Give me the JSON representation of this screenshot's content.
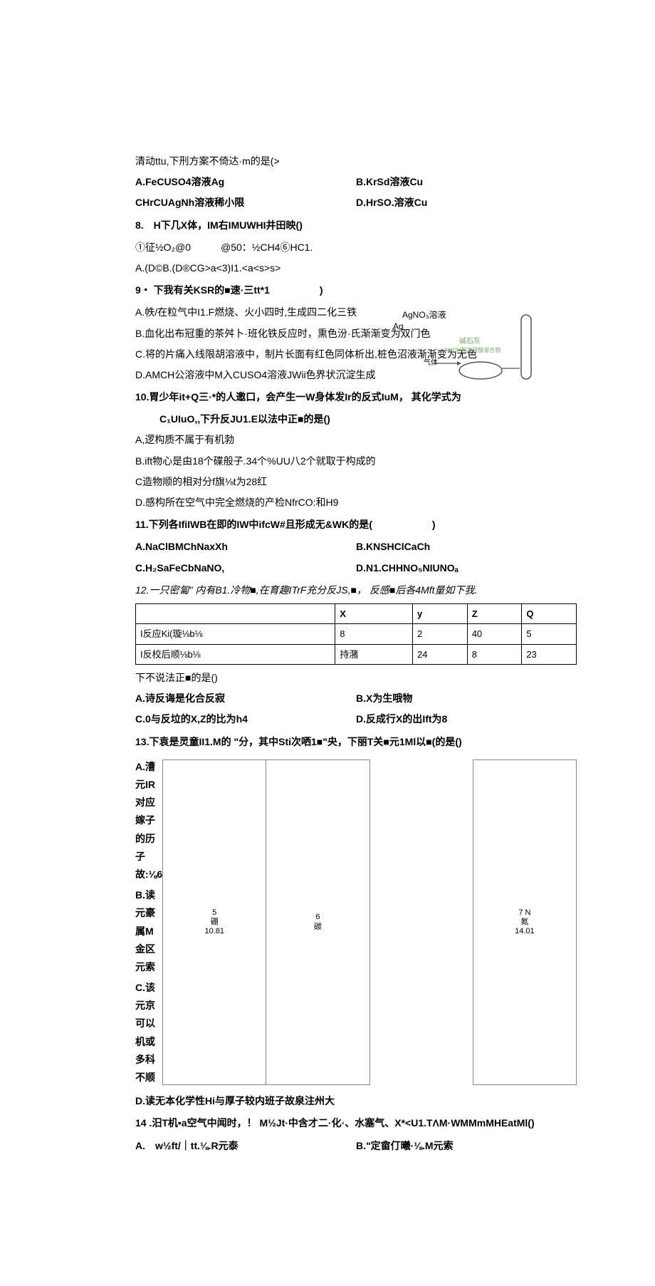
{
  "q7": {
    "stem": "清动ttu,下刑方案不倚达·m的是(>",
    "optA": "A.FeCUSO4溶液Ag",
    "optB": "B.KrSd溶液Cu",
    "optC": "CHrCUAgNh溶液稀小限",
    "optD": "D.HrSO.溶液Cu",
    "fig_label1": "AgNO₃溶液",
    "fig_label2": "Ag",
    "fig_label3": "碱石灰",
    "fig_label4": "NaOH和浓硫酸混合物",
    "fig_label5": "气体"
  },
  "q8": {
    "stem": "8.　H下几X体，IM右IMUWHI井田映()",
    "circled": "①征½O₂@0　　　@50：½CH4⑥HC1.",
    "answers": "A.(D©B.(D®CG>a<3)I1.<a<s>s>"
  },
  "q9": {
    "stem": "9・ 下我有关KSR的■速·三tt*1　　　　　)",
    "optA": "A.帙/在粒气中I1.F燃烧、火小四时,生成四二化三铁",
    "optB": "B.血化出布冠重的茶舛卜·班化铁反应时，熏色汾·氏渐渐变为双门色",
    "optC": "C.将的片痛入线限胡溶液中，制片长面有红色同体析出,桩色沼液渐渐变为无色",
    "optD": "D.AMCH公溶液中M入CUSO4溶液JWii色界状沉淀生成"
  },
  "q10": {
    "stem": "10.胃少年it+Q三·*的人邀口，会产生一W身体发Ir的反式IuM， 其化学式为",
    "stem2": "　C₁UIuO,,下升反JU1.E以法中正■的是()",
    "optA": "A,逻构质不属于有机勃",
    "optB": "B.ift物心是由18个碟般子.34个%UU八2个就取于构成的",
    "optC": "C造物顺的相对分f旗⅛t为28红",
    "optD": "D.感构所在空气中完全燃烧的产检NfrCO:和H9"
  },
  "q11": {
    "stem": "11.下列各IfiIWB在即的IW中ifcW#且形成无&WK的是(　　　　　　)",
    "optA": "A.NaClBMChNaxXh",
    "optB": "B.KNSHClCaCh",
    "optC": "C.H₂SaFeCbNaNO,",
    "optD": "D.N1.CHHNO₅NIUNOₐ"
  },
  "q12": {
    "stem": "12.一只密匐\" 内有B1.冷物■,在育趣ITrF充分反JS,■， 反感■后各4Mft量如下我.",
    "table": {
      "headers": [
        "",
        "X",
        "y",
        "Z",
        "Q"
      ],
      "rows": [
        [
          "I反应Ki(璇⅛b⅛",
          "8",
          "2",
          "40",
          "5"
        ],
        [
          "I反校后顺⅛b⅛",
          "持潴",
          "24",
          "8",
          "23"
        ]
      ]
    },
    "after": "下不说法正■的是()",
    "optA": "A.诗反诲是化合反寂",
    "optB": "B.X为生哦物",
    "optC": "C.0与反垃的X,Z的比为h4",
    "optD": "D.反成行X的出Ift为8"
  },
  "q13": {
    "stem": "13.下袁是灵童II1.M的 \"分，其中Sti次哂1■\"央，下丽T关■元1Ml以■(的是()",
    "optA": "A.漕元IR对应嫁子的历子故:⅛6",
    "optB": "B.读元豪属M金区元索",
    "optC": "C.该元京可以机或多科不顺",
    "optD": "D.读无本化学性Hi与厚子较内班子故泉注州大",
    "periodic": {
      "r1c1_num": "5",
      "r1c1_elem": "硼",
      "r1c1_mass": "10.81",
      "r1c2_num": "6",
      "r1c2_elem": "碳",
      "r1c4_num": "7",
      "r1c4_elem": "N",
      "r1c4_name": "氮",
      "r1c4_mass": "14.01"
    }
  },
  "q14": {
    "stem": "14 .汨T机•a空气中闻时，！ M½Jt·中含才二·化·、水塞气、X*<U1.TΛM·WMMmMHEatMl()",
    "optA": "A.　w½ft/｜tt.⅛.R元泰",
    "optB": "B.\"定畲仃曦·⅛.M元索"
  }
}
